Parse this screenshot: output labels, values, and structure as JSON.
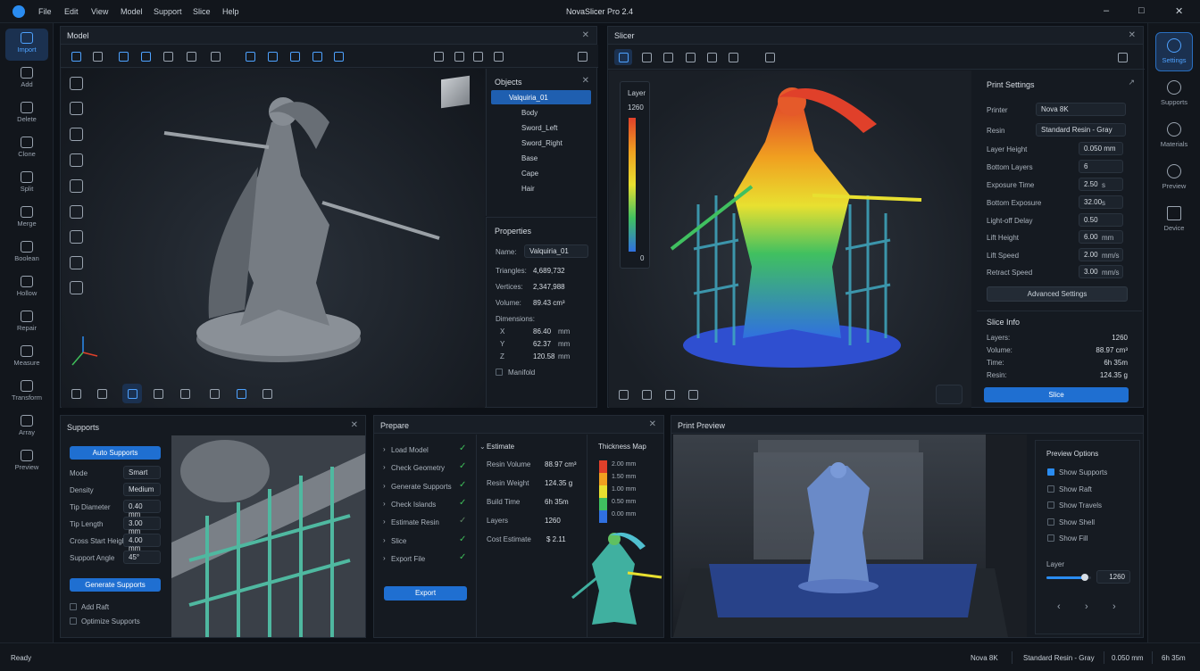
{
  "app": {
    "title": "NovaSlicer Pro 2.4"
  },
  "menu": [
    "File",
    "Edit",
    "View",
    "Model",
    "Support",
    "Slice",
    "Help"
  ],
  "left_tools": [
    "Import",
    "Add",
    "Delete",
    "Clone",
    "Split",
    "Merge",
    "Boolean",
    "Hollow",
    "Repair",
    "Measure",
    "Transform",
    "Array",
    "Preview"
  ],
  "right_tools": [
    "Settings",
    "Supports",
    "Materials",
    "Preview",
    "Device"
  ],
  "model_panel": {
    "title": "Model",
    "objects": {
      "title": "Objects",
      "root": "Valquiria_01",
      "children": [
        "Body",
        "Sword_Left",
        "Sword_Right",
        "Base",
        "Cape",
        "Hair"
      ]
    },
    "properties": {
      "title": "Properties",
      "name_label": "Name:",
      "name": "Valquiria_01",
      "triangles_label": "Triangles:",
      "triangles": "4,689,732",
      "vertices_label": "Vertices:",
      "vertices": "2,347,988",
      "volume_label": "Volume:",
      "volume": "89.43 cm³",
      "dimensions_label": "Dimensions:",
      "x_label": "X",
      "x": "86.40",
      "y_label": "Y",
      "y": "62.37",
      "z_label": "Z",
      "z": "120.58",
      "unit": "mm",
      "manifold": "Manifold"
    }
  },
  "slicer_panel": {
    "title": "Slicer",
    "layer": {
      "label": "Layer",
      "max": "1260",
      "min": "0"
    },
    "print_settings": {
      "title": "Print Settings",
      "rows": [
        {
          "label": "Printer",
          "value": "Nova 8K",
          "unit": ""
        },
        {
          "label": "Resin",
          "value": "Standard Resin - Gray",
          "unit": ""
        },
        {
          "label": "Layer Height",
          "value": "0.050 mm",
          "unit": ""
        },
        {
          "label": "Bottom Layers",
          "value": "6",
          "unit": ""
        },
        {
          "label": "Exposure Time",
          "value": "2.50",
          "unit": "s"
        },
        {
          "label": "Bottom Exposure",
          "value": "32.00",
          "unit": "s"
        },
        {
          "label": "Light-off Delay",
          "value": "0.50",
          "unit": ""
        },
        {
          "label": "Lift Height",
          "value": "6.00",
          "unit": "mm"
        },
        {
          "label": "Lift Speed",
          "value": "2.00",
          "unit": "mm/s"
        },
        {
          "label": "Retract Speed",
          "value": "3.00",
          "unit": "mm/s"
        }
      ],
      "advanced": "Advanced Settings"
    },
    "slice_info": {
      "title": "Slice Info",
      "rows": [
        {
          "label": "Layers:",
          "value": "1260"
        },
        {
          "label": "Volume:",
          "value": "88.97 cm³"
        },
        {
          "label": "Time:",
          "value": "6h 35m"
        },
        {
          "label": "Resin:",
          "value": "124.35 g"
        }
      ],
      "slice_button": "Slice"
    }
  },
  "supports_panel": {
    "title": "Supports",
    "auto_button": "Auto Supports",
    "rows": [
      {
        "label": "Mode",
        "value": "Smart"
      },
      {
        "label": "Density",
        "value": "Medium"
      },
      {
        "label": "Tip Diameter",
        "value": "0.40 mm"
      },
      {
        "label": "Tip Length",
        "value": "3.00 mm"
      },
      {
        "label": "Cross Start Height",
        "value": "4.00 mm"
      },
      {
        "label": "Support Angle",
        "value": "45°"
      }
    ],
    "generate_button": "Generate Supports",
    "add_raft": "Add Raft",
    "optimize": "Optimize Supports"
  },
  "prepare_panel": {
    "title": "Prepare",
    "steps": [
      "Load Model",
      "Check Geometry",
      "Generate Supports",
      "Check Islands",
      "Estimate Resin",
      "Slice",
      "Export File"
    ],
    "export_button": "Export",
    "estimate": {
      "title": "Estimate",
      "rows": [
        {
          "label": "Resin Volume",
          "value": "88.97 cm³"
        },
        {
          "label": "Resin Weight",
          "value": "124.35 g"
        },
        {
          "label": "Build Time",
          "value": "6h 35m"
        },
        {
          "label": "Layers",
          "value": "1260"
        },
        {
          "label": "Cost Estimate",
          "value": "$ 2.11"
        }
      ]
    },
    "thickness": {
      "title": "Thickness Map",
      "levels": [
        "2.00 mm",
        "1.50 mm",
        "1.00 mm",
        "0.50 mm",
        "0.00 mm"
      ],
      "colors": [
        "#e0402a",
        "#f0a020",
        "#e8e030",
        "#40c060",
        "#3070e0"
      ]
    }
  },
  "preview_panel": {
    "title": "Print Preview",
    "options_title": "Preview Options",
    "options": [
      {
        "label": "Show Supports",
        "on": true
      },
      {
        "label": "Show Raft",
        "on": false
      },
      {
        "label": "Show Travels",
        "on": false
      },
      {
        "label": "Show Shell",
        "on": false
      },
      {
        "label": "Show Fill",
        "on": false
      }
    ],
    "layer_label": "Layer",
    "layer_value": "1260",
    "layer_fraction": 0.85
  },
  "status": {
    "left": "Ready",
    "printer": "Nova 8K",
    "resin": "Standard Resin - Gray",
    "layer": "0.050 mm",
    "time": "6h 35m"
  },
  "colors": {
    "accent": "#2a8cf0",
    "ok": "#3fbf5a",
    "bg": "#0d1117"
  }
}
